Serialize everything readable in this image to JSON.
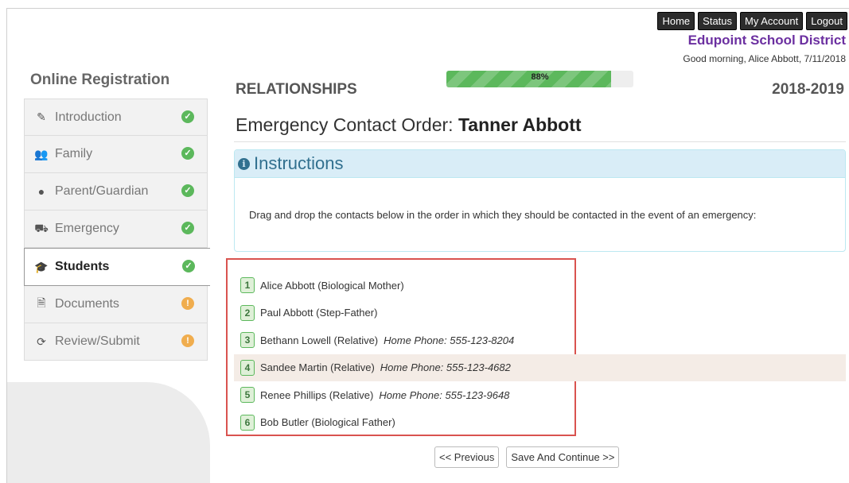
{
  "topnav": {
    "items": [
      "Home",
      "Status",
      "My Account",
      "Logout"
    ]
  },
  "district": "Edupoint School District",
  "greeting": "Good morning, Alice Abbott, 7/11/2018",
  "sidebar": {
    "title": "Online Registration",
    "items": [
      {
        "label": "Introduction",
        "icon": "pencil-icon",
        "status": "complete"
      },
      {
        "label": "Family",
        "icon": "users-icon",
        "status": "complete"
      },
      {
        "label": "Parent/Guardian",
        "icon": "user-icon",
        "status": "complete"
      },
      {
        "label": "Emergency",
        "icon": "ambulance-icon",
        "status": "complete"
      },
      {
        "label": "Students",
        "icon": "graduation-cap-icon",
        "status": "complete",
        "active": true
      },
      {
        "label": "Documents",
        "icon": "document-icon",
        "status": "warning"
      },
      {
        "label": "Review/Submit",
        "icon": "refresh-icon",
        "status": "warning"
      }
    ]
  },
  "section": {
    "title": "RELATIONSHIPS",
    "year": "2018-2019",
    "progress_label": "88%",
    "progress_value": 0.88
  },
  "heading": {
    "prefix": "Emergency Contact Order:",
    "student": "Tanner Abbott"
  },
  "instructions": {
    "title": "Instructions",
    "body": "Drag and drop the contacts below in the order in which they should be contacted in the event of an emergency:"
  },
  "contacts": [
    {
      "order": "1",
      "name": "Alice Abbott (Biological Mother)",
      "phone": ""
    },
    {
      "order": "2",
      "name": "Paul Abbott (Step-Father)",
      "phone": ""
    },
    {
      "order": "3",
      "name": "Bethann Lowell (Relative)",
      "phone": "Home Phone: 555-123-8204"
    },
    {
      "order": "4",
      "name": "Sandee Martin (Relative)",
      "phone": "Home Phone: 555-123-4682"
    },
    {
      "order": "5",
      "name": "Renee Phillips (Relative)",
      "phone": "Home Phone: 555-123-9648"
    },
    {
      "order": "6",
      "name": "Bob Butler (Biological Father)",
      "phone": ""
    }
  ],
  "actions": {
    "previous": "<< Previous",
    "save": "Save And Continue >>"
  },
  "colors": {
    "brand": "#6b2fa0",
    "success": "#5cb85c",
    "warning": "#f0ad4e",
    "info": "#31708f",
    "highlight_border": "#d9534f"
  }
}
